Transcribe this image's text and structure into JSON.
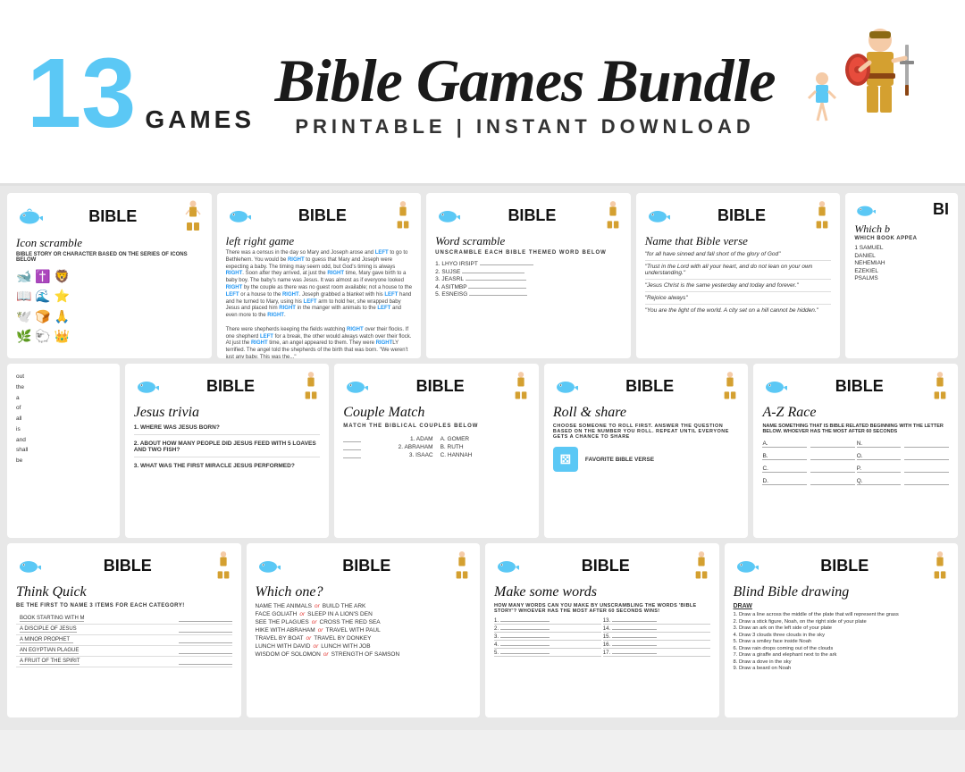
{
  "header": {
    "number": "13",
    "games_label": "GAMES",
    "title": "Bible Games Bundle",
    "subtitle": "PRINTABLE | INSTANT DOWNLOAD"
  },
  "row1": [
    {
      "id": "icon-scramble",
      "bible_label": "BIBLE",
      "game_title": "Icon scramble",
      "description": "BIBLE STORY OR CHARACTER BASED ON THE SERIES OF ICONS BELOW"
    },
    {
      "id": "left-right",
      "bible_label": "BIBLE",
      "game_title": "left right game",
      "description": "There was a census in the day so Mary and Joseph arose and LEFT to go to Bethlehem. You would be RIGHT to guess that Mary and Joseph were expecting a baby. The timing may seem odd, but God's timing is always RIGHT. Soon after they arrived, at just the RIGHT time, Mary gave birth to a baby boy..."
    },
    {
      "id": "word-scramble",
      "bible_label": "BIBLE",
      "game_title": "Word scramble",
      "description": "UNSCRAMBLE EACH BIBLE THEMED WORD BELOW",
      "items": [
        "LHYO IRSIPT",
        "SUJSE",
        "JEASRL",
        "ASITMBP",
        "ESNEISG"
      ]
    },
    {
      "id": "name-bible-verse",
      "bible_label": "BIBLE",
      "game_title": "Name that Bible verse",
      "verses": [
        "\"for all have sinned and fall short of the glory of God\"",
        "\"Trust in the Lord with all your heart, and do not lean on your own understanding.\"",
        "\"Jesus Christ is the same yesterday and today and forever.\"",
        "\"Rejoice always\"",
        "\"You are the light of the world. A city set on a hill cannot be hidden.\""
      ]
    },
    {
      "id": "which-book",
      "bible_label": "BI",
      "game_title": "Which b",
      "description": "WHICH BOOK APPEA",
      "items": [
        "1 SAMUEL",
        "DANIEL",
        "NEHEMIAH",
        "EZEKIEL",
        "PSALMS"
      ]
    }
  ],
  "row2": [
    {
      "id": "jesus-trivia",
      "bible_label": "BIBLE",
      "game_title": "Jesus trivia",
      "questions": [
        "1. WHERE WAS JESUS BORN?",
        "2. ABOUT HOW MANY PEOPLE DID JESUS FEED WITH 5 LOAVES AND TWO FISH?",
        "3. WHAT WAS THE FIRST MIRACLE JESUS PERFORMED?"
      ]
    },
    {
      "id": "couple-match",
      "bible_label": "BIBLE",
      "game_title": "Couple Match",
      "subtitle": "MATCH THE BIBLICAL COUPLES BELOW",
      "left": [
        "1. ADAM",
        "2. ABRAHAM",
        "3. ISAAC"
      ],
      "right": [
        "A. GOMER",
        "B. RUTH",
        "C. HANNAH"
      ]
    },
    {
      "id": "roll-share",
      "bible_label": "BIBLE",
      "game_title": "Roll & share",
      "description": "CHOOSE SOMEONE TO ROLL FIRST. ANSWER THE QUESTION BASED ON THE NUMBER YOU ROLL. REPEAT UNTIL EVERYONE GETS A CHANCE TO SHARE",
      "items": [
        "FAVORITE BIBLE VERSE"
      ]
    },
    {
      "id": "az-race",
      "bible_label": "BIBLE",
      "game_title": "A-Z Race",
      "description": "NAME SOMETHING THAT IS BIBLE RELATED BEGINNING WITH THE LETTER BELOW. WHOEVER HAS THE MOST AFTER 60 SECONDS",
      "letters": [
        "A.",
        "B.",
        "C.",
        "D.",
        "N.",
        "O.",
        "P.",
        "Q."
      ]
    }
  ],
  "row3": [
    {
      "id": "think-quick",
      "bible_label": "BIBLE",
      "game_title": "Think Quick",
      "subtitle": "BE THE FIRST TO NAME 3 ITEMS FOR EACH CATEGORY!",
      "items": [
        "BOOK STARTING WITH M",
        "A DISCIPLE OF JESUS",
        "A MINOR PROPHET",
        "AN EGYPTIAN PLAGUE",
        "A FRUIT OF THE SPIRIT"
      ]
    },
    {
      "id": "which-one",
      "bible_label": "BIBLE",
      "game_title": "Which one?",
      "pairs": [
        [
          "NAME THE ANIMALS",
          "BUILD THE ARK"
        ],
        [
          "FACE GOLIATH",
          "SLEEP IN A LION'S DEN"
        ],
        [
          "SEE THE PLAGUES",
          "CROSS THE RED SEA"
        ],
        [
          "HIKE WITH ABRAHAM",
          "TRAVEL WITH PAUL"
        ],
        [
          "TRAVEL BY BOAT",
          "TRAVEL BY DONKEY"
        ],
        [
          "LUNCH WITH DAVID",
          "LUNCH WITH JOB"
        ],
        [
          "WISDOM OF SOLOMON",
          "STRENGTH OF SAMSON"
        ]
      ]
    },
    {
      "id": "make-words",
      "bible_label": "BIBLE",
      "game_title": "Make some words",
      "description": "HOW MANY WORDS CAN YOU MAKE BY UNSCRAMBLING THE WORDS 'BIBLE STORY'? WHOEVER HAS THE MOST AFTER 60 SECONDS WINS!",
      "numbers": [
        "1.",
        "2.",
        "3.",
        "4.",
        "5.",
        "13.",
        "14.",
        "15.",
        "16.",
        "17."
      ]
    },
    {
      "id": "blind-drawing",
      "bible_label": "BIBLE",
      "game_title": "Blind Bible drawing",
      "subtitle": "DRAW",
      "instructions": [
        "1. Draw a line across the middle of the plate that will represent the grass",
        "2. Draw a stick figure, Noah, on the right side of your plate",
        "3. Draw an ark on the left side of your plate",
        "4. Draw 3 clouds three clouds in the sky",
        "5. Draw a smiley face inside Noah",
        "6. Draw rain drops coming out of the clouds",
        "7. Draw a giraffe and elephant next to the ark",
        "8. Draw a dove in the sky",
        "9. Draw a beard on Noah"
      ]
    }
  ]
}
